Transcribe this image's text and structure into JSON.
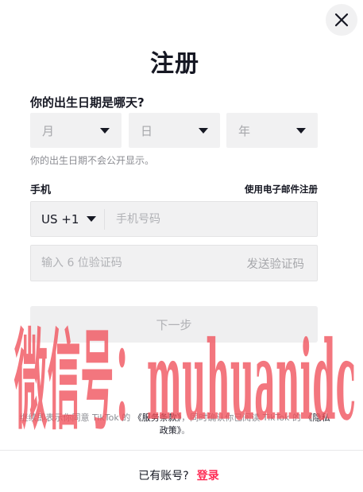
{
  "title": "注册",
  "birthday": {
    "question": "你的出生日期是哪天?",
    "month_placeholder": "月",
    "day_placeholder": "日",
    "year_placeholder": "年",
    "hint": "你的出生日期不会公开显示。"
  },
  "phone": {
    "label": "手机",
    "email_link": "使用电子邮件注册",
    "country_code": "US +1",
    "placeholder": "手机号码"
  },
  "code": {
    "placeholder": "输入 6 位验证码",
    "send_label": "发送验证码"
  },
  "next_label": "下一步",
  "terms": {
    "prefix": "继续即表示你同意 TikTok 的 ",
    "terms_link": "《服务条款》",
    "middle": "，同时确认你已阅读 TikTok 的 ",
    "privacy_link": "《隐私政策》",
    "suffix": "。"
  },
  "footer": {
    "have_account": "已有账号?",
    "login": "登录"
  },
  "watermark": {
    "text": "微信号：muhuanidc",
    "color": "#f0505a"
  },
  "colors": {
    "accent": "#fe2c55",
    "field_bg": "#f1f1f2",
    "text": "#161823"
  }
}
